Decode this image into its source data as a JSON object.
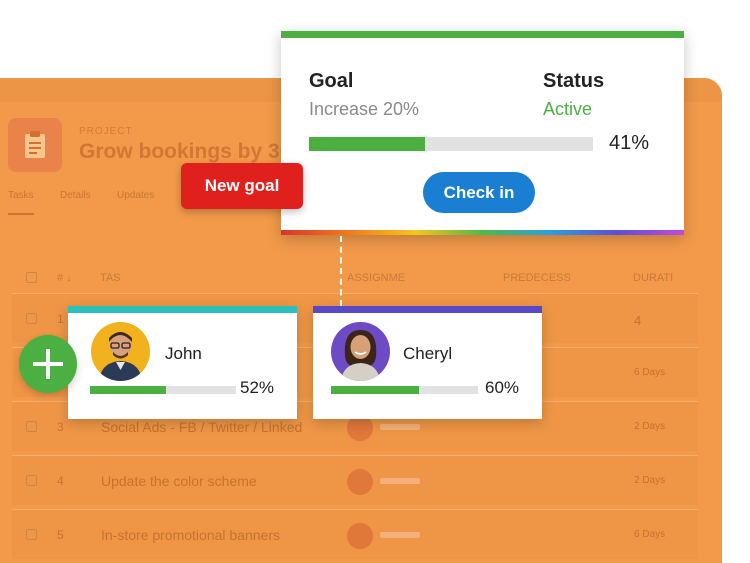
{
  "project": {
    "kicker": "PROJECT",
    "title": "Grow bookings by 30%"
  },
  "tabs": [
    {
      "label": "Tasks",
      "active": true
    },
    {
      "label": "Details",
      "active": false
    },
    {
      "label": "Updates",
      "active": false
    }
  ],
  "table": {
    "headers": {
      "number": "#",
      "task": "TAS",
      "assignee": "ASSIGNME",
      "predecessor": "PREDECESS",
      "duration": "DURATI"
    },
    "rows": [
      {
        "num": "1",
        "name": "",
        "duration": "4"
      },
      {
        "num": "2",
        "name": "",
        "duration": "6 Days"
      },
      {
        "num": "3",
        "name": "Social Ads - FB / Twitter / Linked",
        "duration": "2 Days"
      },
      {
        "num": "4",
        "name": "Update the color scheme",
        "duration": "2 Days"
      },
      {
        "num": "5",
        "name": "In-store promotional banners",
        "duration": "6 Days"
      }
    ]
  },
  "goal_card": {
    "goal_label": "Goal",
    "goal_value": "Increase 20%",
    "status_label": "Status",
    "status_value": "Active",
    "progress_pct": 41,
    "progress_text": "41%",
    "checkin_label": "Check in",
    "accent_color": "#4caf42",
    "button_color": "#1a7fd3"
  },
  "new_goal_tag": {
    "label": "New goal",
    "color": "#e0201c"
  },
  "people": [
    {
      "name": "John",
      "progress_pct": 52,
      "progress_text": "52%",
      "stripe_color": "#2bbfbe",
      "avatar_bg": "#f2b21d"
    },
    {
      "name": "Cheryl",
      "progress_pct": 60,
      "progress_text": "60%",
      "stripe_color": "#5849c8",
      "avatar_bg": "#6c4bc4"
    }
  ],
  "icons": {
    "project": "clipboard-icon",
    "add": "plus-icon",
    "sort": "sort-arrow-icon"
  }
}
